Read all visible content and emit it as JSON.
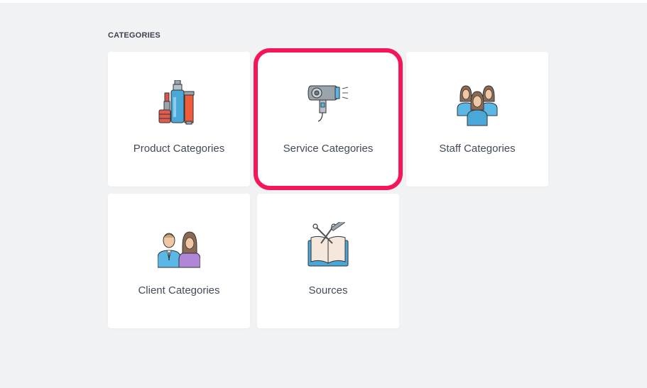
{
  "section": {
    "title": "CATEGORIES"
  },
  "cards": [
    {
      "label": "Product Categories",
      "icon": "cosmetics-icon"
    },
    {
      "label": "Service Categories",
      "icon": "hair-dryer-icon"
    },
    {
      "label": "Staff Categories",
      "icon": "staff-group-icon"
    },
    {
      "label": "Client Categories",
      "icon": "client-couple-icon"
    },
    {
      "label": "Sources",
      "icon": "book-scissors-icon"
    }
  ],
  "colors": {
    "background": "#f1f2f4",
    "card": "#ffffff",
    "highlight": "#f5155a",
    "text": "#434a59"
  }
}
